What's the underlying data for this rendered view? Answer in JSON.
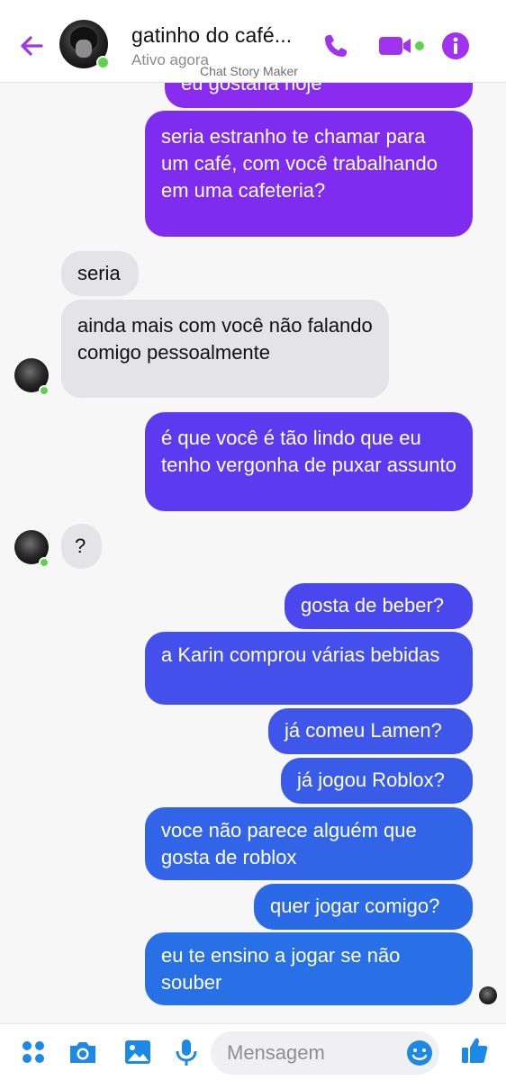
{
  "header": {
    "contact_name": "gatinho do café...",
    "status": "Ativo agora",
    "watermark": "Chat Story Maker"
  },
  "colors": {
    "accent": "#a033f0",
    "online": "#5bd449",
    "composer_blue": "#1e88e5",
    "bubble_them": "#e4e4e7"
  },
  "messages": [
    {
      "from": "me",
      "text": "eu gostaria hoje",
      "color": "#8a2bf0"
    },
    {
      "from": "me",
      "text": "seria estranho te chamar para um café, com você trabalhando em uma cafeteria?",
      "color": "#7e2cf0"
    },
    {
      "from": "them",
      "text": "seria"
    },
    {
      "from": "them",
      "text": "ainda mais com você não falando comigo pessoalmente"
    },
    {
      "from": "me",
      "text": "é que você é tão lindo que eu tenho vergonha de puxar assunto",
      "color": "#5b3af0"
    },
    {
      "from": "them",
      "text": "?"
    },
    {
      "from": "me",
      "text": "gosta de beber?",
      "color": "#4a47ee"
    },
    {
      "from": "me",
      "text": "a Karin comprou várias bebidas",
      "color": "#4450ec"
    },
    {
      "from": "me",
      "text": "já comeu Lamen?",
      "color": "#3e56ea"
    },
    {
      "from": "me",
      "text": "já jogou Roblox?",
      "color": "#385ce8"
    },
    {
      "from": "me",
      "text": "voce não parece alguém que gosta de roblox",
      "color": "#3164e7"
    },
    {
      "from": "me",
      "text": "quer jogar comigo?",
      "color": "#2b6ae6"
    },
    {
      "from": "me",
      "text": "eu te ensino a jogar se não souber",
      "color": "#2870e6"
    }
  ],
  "composer": {
    "placeholder": "Mensagem",
    "icons": [
      "apps-icon",
      "camera-icon",
      "image-icon",
      "microphone-icon",
      "emoji-icon",
      "thumbs-up-icon"
    ]
  }
}
